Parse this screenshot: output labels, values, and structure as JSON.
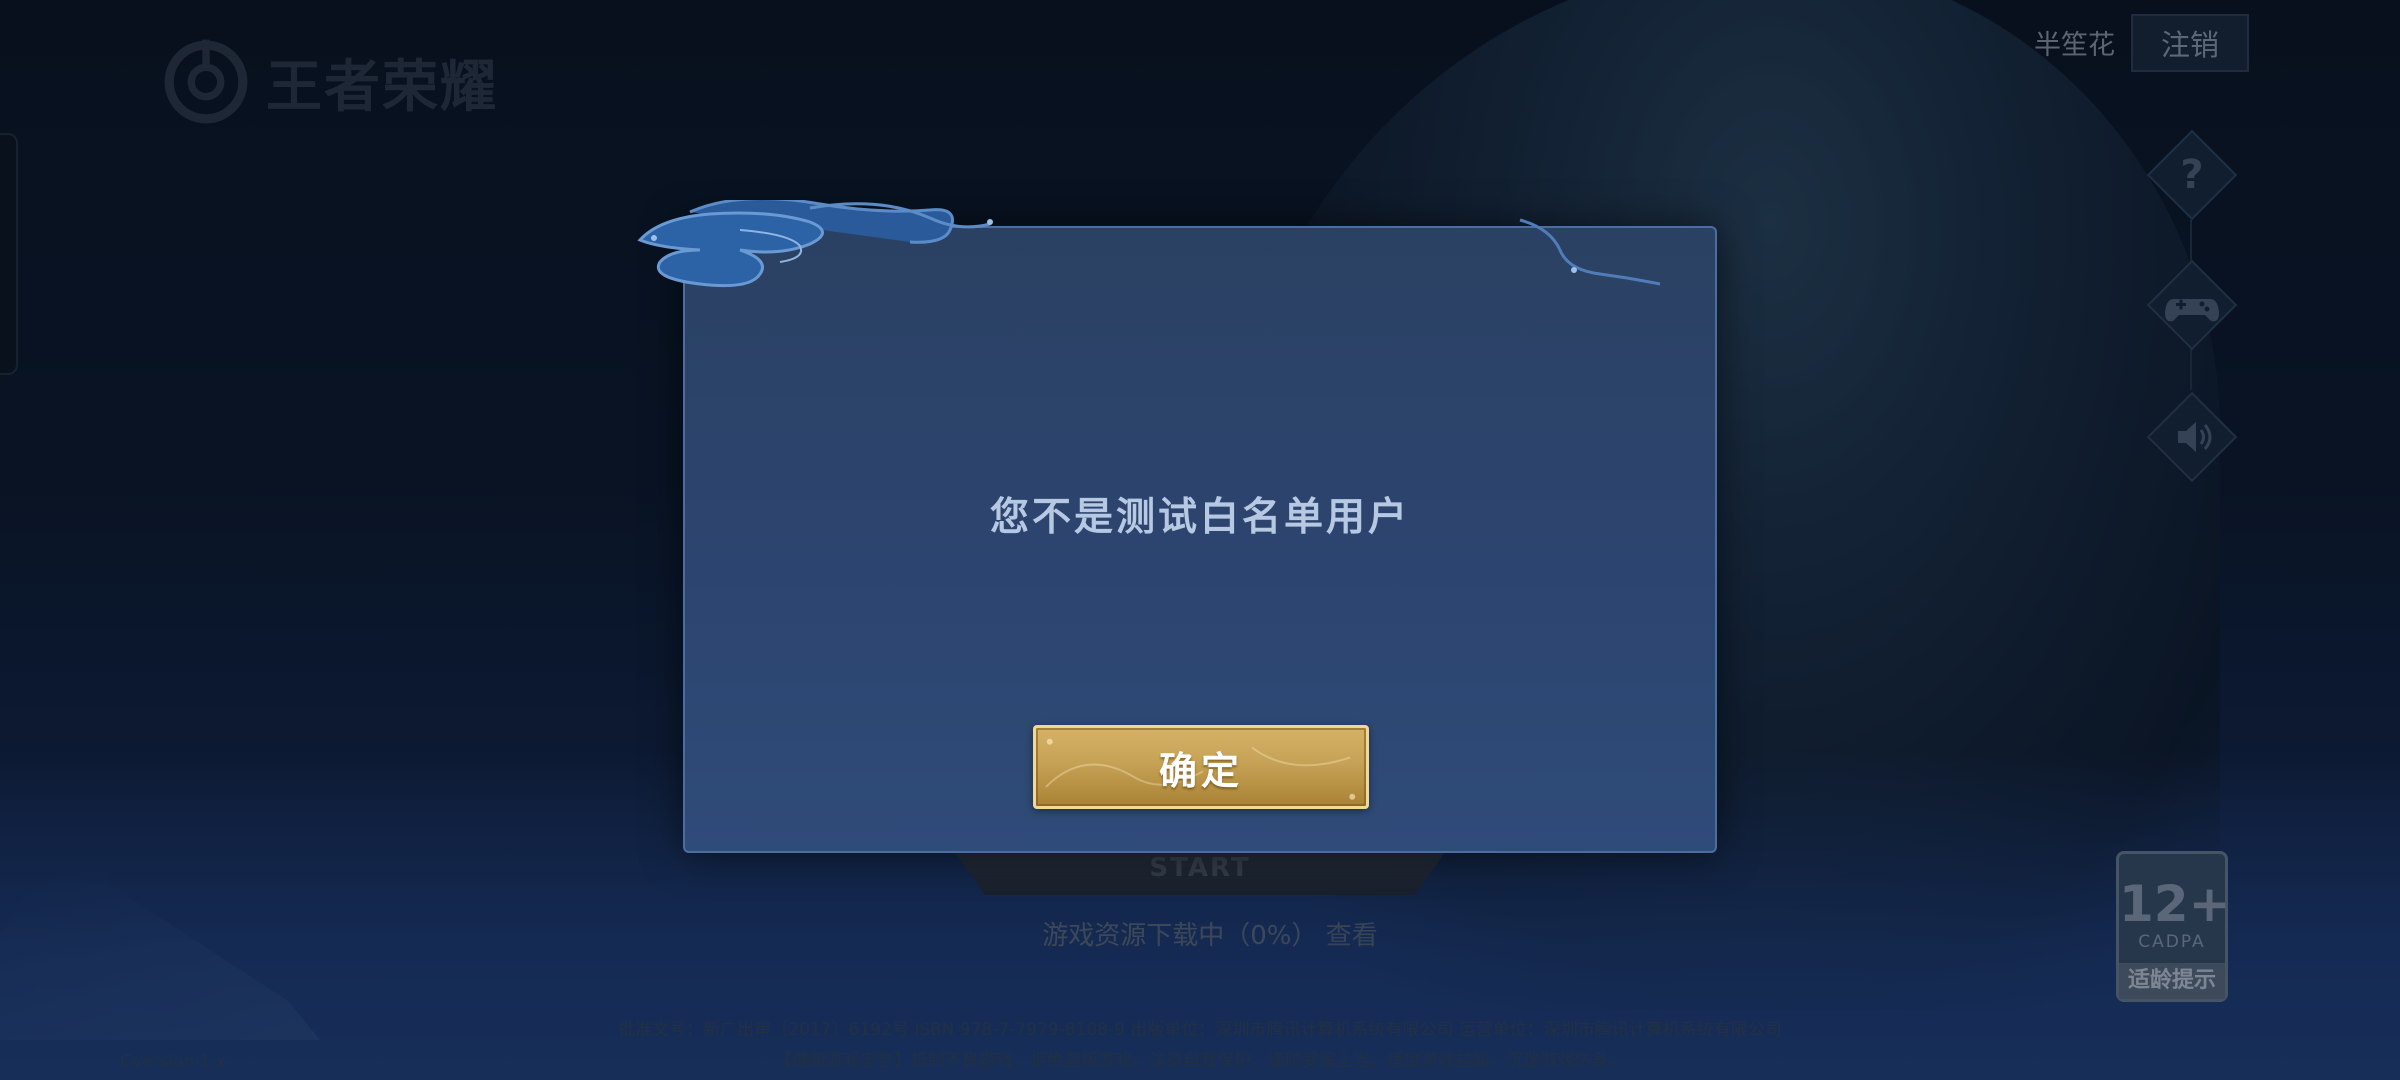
{
  "game": {
    "logo_text": "王者荣耀"
  },
  "account": {
    "username": "半笙花",
    "logout_label": "注销"
  },
  "side_icons": [
    {
      "name": "help-icon",
      "glyph": "?"
    },
    {
      "name": "gamepad-icon",
      "glyph": "🎮"
    },
    {
      "name": "sound-icon",
      "glyph": "🔊"
    }
  ],
  "age_rating": {
    "age": "12+",
    "org": "CADPA",
    "tip": "适龄提示"
  },
  "start": {
    "label": "START"
  },
  "download": {
    "text": "游戏资源下载中（0%）",
    "view_link": "查看"
  },
  "footer": {
    "license_line1": "批准文号：新广出审〔2017〕6192号 ISBN 978-7-7979-8108-9 出版单位：深圳市腾讯计算机系统有限公司 运营单位：深圳市腾讯计算机系统有限公司",
    "license_line2": "【健康游戏忠告】抵制不良游戏，拒绝盗版游戏。注意自我保护，谨防受骗上当。适度游戏益脑，沉迷游戏伤身。",
    "version": "Cversion:1.x"
  },
  "dialog": {
    "message": "您不是测试白名单用户",
    "confirm_label": "确定"
  },
  "colors": {
    "dialog_bg": "#2c4570",
    "dialog_border": "#4a6ea0",
    "button_gold": "#c6a256",
    "message_text": "#b6c8e2"
  }
}
